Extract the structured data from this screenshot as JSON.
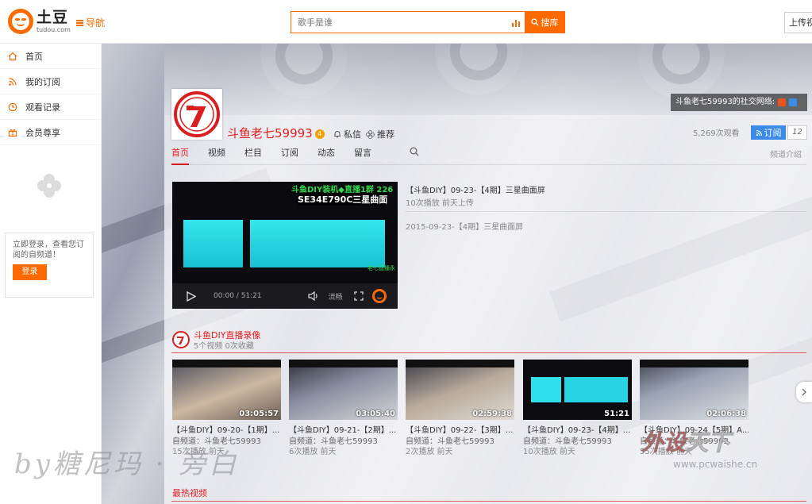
{
  "header": {
    "logo_cn": "土豆",
    "logo_en": "tudou.com",
    "nav_label": "导航",
    "search_placeholder": "歌手是谁",
    "search_button": "搜库",
    "upload_label": "上传视"
  },
  "sidebar": {
    "items": [
      {
        "label": "首页",
        "icon": "home-icon"
      },
      {
        "label": "我的订阅",
        "icon": "rss-icon"
      },
      {
        "label": "观看记录",
        "icon": "clock-icon"
      },
      {
        "label": "会员尊享",
        "icon": "gift-icon"
      }
    ],
    "login_text": "立即登录，查看您订阅的自频道！",
    "login_button": "登录"
  },
  "channel": {
    "social_label": "斗鱼老七59993的社交网络:",
    "name": "斗鱼老七59993",
    "level": "4",
    "message_label": "私信",
    "recommend_label": "推荐",
    "views": "5,269次观看",
    "subscribe_label": "订阅",
    "subscribe_count": "12",
    "intro_label": "频道介绍",
    "tabs": [
      "首页",
      "视频",
      "栏目",
      "订阅",
      "动态",
      "留言"
    ]
  },
  "featured": {
    "overlay_line1": "斗鱼DIY装机◆直播1群 226",
    "overlay_line2": "SE34E790C三星曲面",
    "overlay_line3": "老七直播永",
    "time": "00:00 / 51:21",
    "quality": "流畅",
    "title": "【斗鱼DIY】09-23-【4期】三星曲面屏",
    "meta": "10次播放    前天上传",
    "related": "2015-09-23-【4期】三星曲面屏"
  },
  "playlist": {
    "title": "斗鱼DIY直播录像",
    "meta": "5个视频    0次收藏",
    "videos": [
      {
        "duration": "03:05:57",
        "title": "【斗鱼DIY】09-20-【1期】...",
        "channel": "自频道：斗鱼老七59993",
        "meta": "15次播放    前天"
      },
      {
        "duration": "03:05:40",
        "title": "【斗鱼DIY】09-21-【2期】...",
        "channel": "自频道：斗鱼老七59993",
        "meta": "6次播放    前天"
      },
      {
        "duration": "02:59:38",
        "title": "【斗鱼DIY】09-22-【3期】...",
        "channel": "自频道：斗鱼老七59993",
        "meta": "2次播放    前天"
      },
      {
        "duration": "51:21",
        "title": "【斗鱼DIY】09-23-【4期】...",
        "channel": "自频道：斗鱼老七59993",
        "meta": "10次播放    前天"
      },
      {
        "duration": "02:06:38",
        "title": "【斗鱼DIY】09-24【5期】A...",
        "channel": "自频道：斗鱼老七59993",
        "meta": "55次播放    前天"
      }
    ]
  },
  "hot_title": "最热视频",
  "watermarks": {
    "left": "by糖尼玛 · 旁白",
    "right_a": "外设",
    "right_b": "天下",
    "right_url": "www.pcwaishe.cn"
  },
  "colors": {
    "accent": "#ff6a00",
    "channel_red": "#e02020",
    "subscribe_blue": "#3c8ce7"
  }
}
